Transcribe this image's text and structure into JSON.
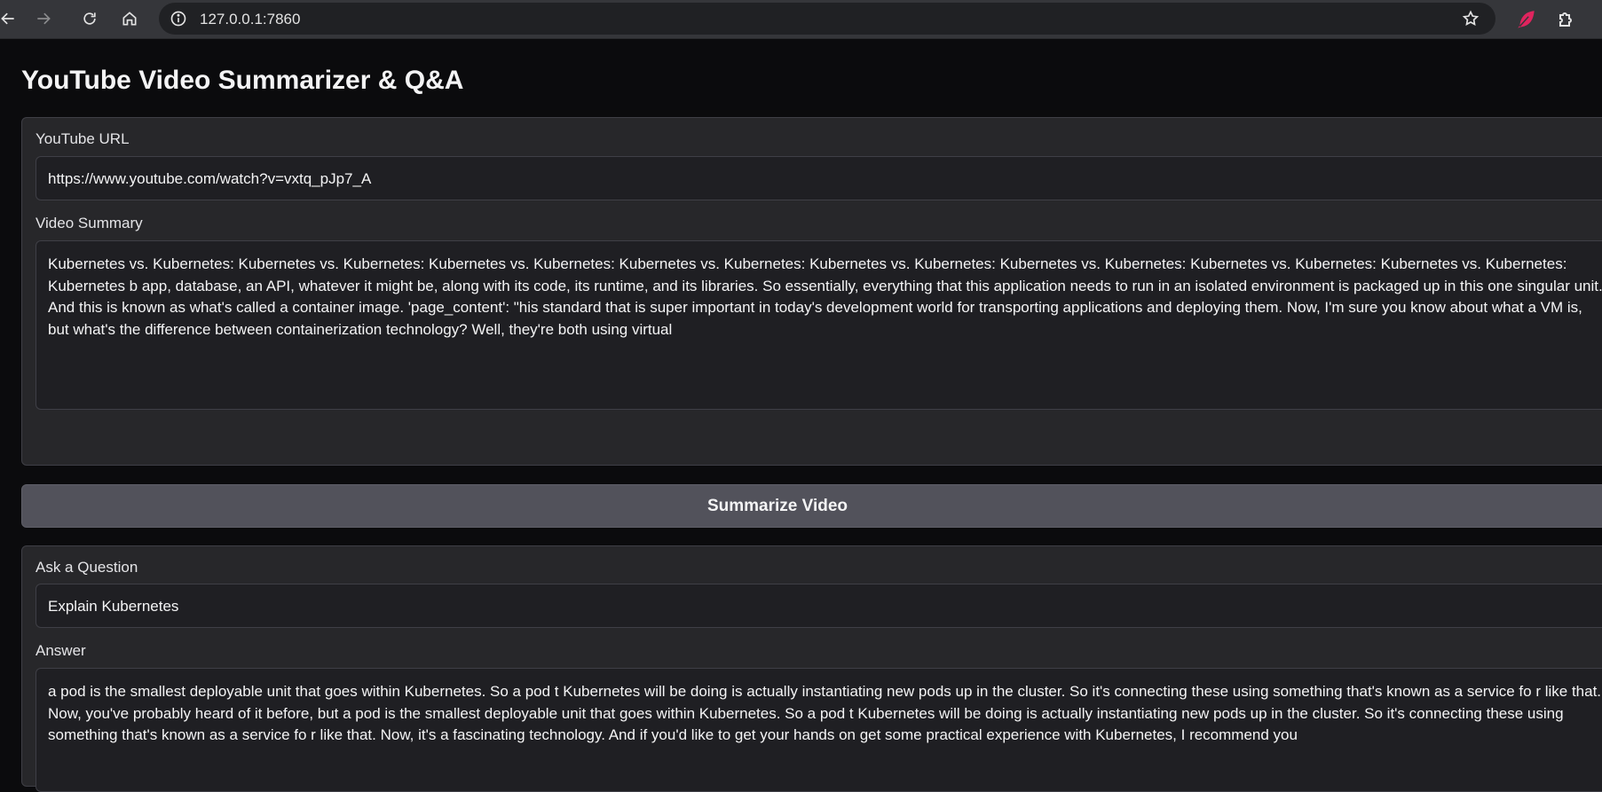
{
  "browser": {
    "url": "127.0.0.1:7860",
    "icons": {
      "back": "back-arrow-icon",
      "forward": "forward-arrow-icon",
      "reload": "reload-icon",
      "home": "home-icon",
      "info": "info-icon",
      "bookmark": "star-icon",
      "extension_1": "feather-icon",
      "extensions": "puzzle-icon"
    }
  },
  "app": {
    "title": "YouTube Video Summarizer & Q&A"
  },
  "url_field": {
    "label": "YouTube URL",
    "value": "https://www.youtube.com/watch?v=vxtq_pJp7_A"
  },
  "summary_field": {
    "label": "Video Summary",
    "value": "Kubernetes vs. Kubernetes: Kubernetes vs. Kubernetes: Kubernetes vs. Kubernetes: Kubernetes vs. Kubernetes: Kubernetes vs. Kubernetes: Kubernetes vs. Kubernetes: Kubernetes vs. Kubernetes: Kubernetes vs. Kubernetes: Kubernetes b app, database, an API, whatever it might be, along with its code, its runtime, and its libraries. So essentially, everything that this application needs to run in an isolated environment is packaged up in this one singular unit. And this is known as what's called a container image. 'page_content': \"his standard that is super important in today's development world for transporting applications and deploying them. Now, I'm sure you know about what a VM is, but what's the difference between containerization technology? Well, they're both using virtual"
  },
  "summarize_button": {
    "label": "Summarize Video"
  },
  "question_field": {
    "label": "Ask a Question",
    "value": "Explain Kubernetes"
  },
  "answer_field": {
    "label": "Answer",
    "value": "a pod is the smallest deployable unit that goes within Kubernetes. So a pod t Kubernetes will be doing is actually instantiating new pods up in the cluster. So it's connecting these using something that's known as a service fo r like that. Now, you've probably heard of it before, but a pod is the smallest deployable unit that goes within Kubernetes. So a pod t Kubernetes will be doing is actually instantiating new pods up in the cluster. So it's connecting these using something that's known as a service fo r like that. Now, it's a fascinating technology. And if you'd like to get your hands on get some practical experience with Kubernetes, I recommend you"
  },
  "colors": {
    "page_bg": "#0b0b0d",
    "panel_bg": "#27272a",
    "input_bg": "#1f1f23",
    "button_bg": "#52525b",
    "extension_accent": "#e0245e"
  }
}
